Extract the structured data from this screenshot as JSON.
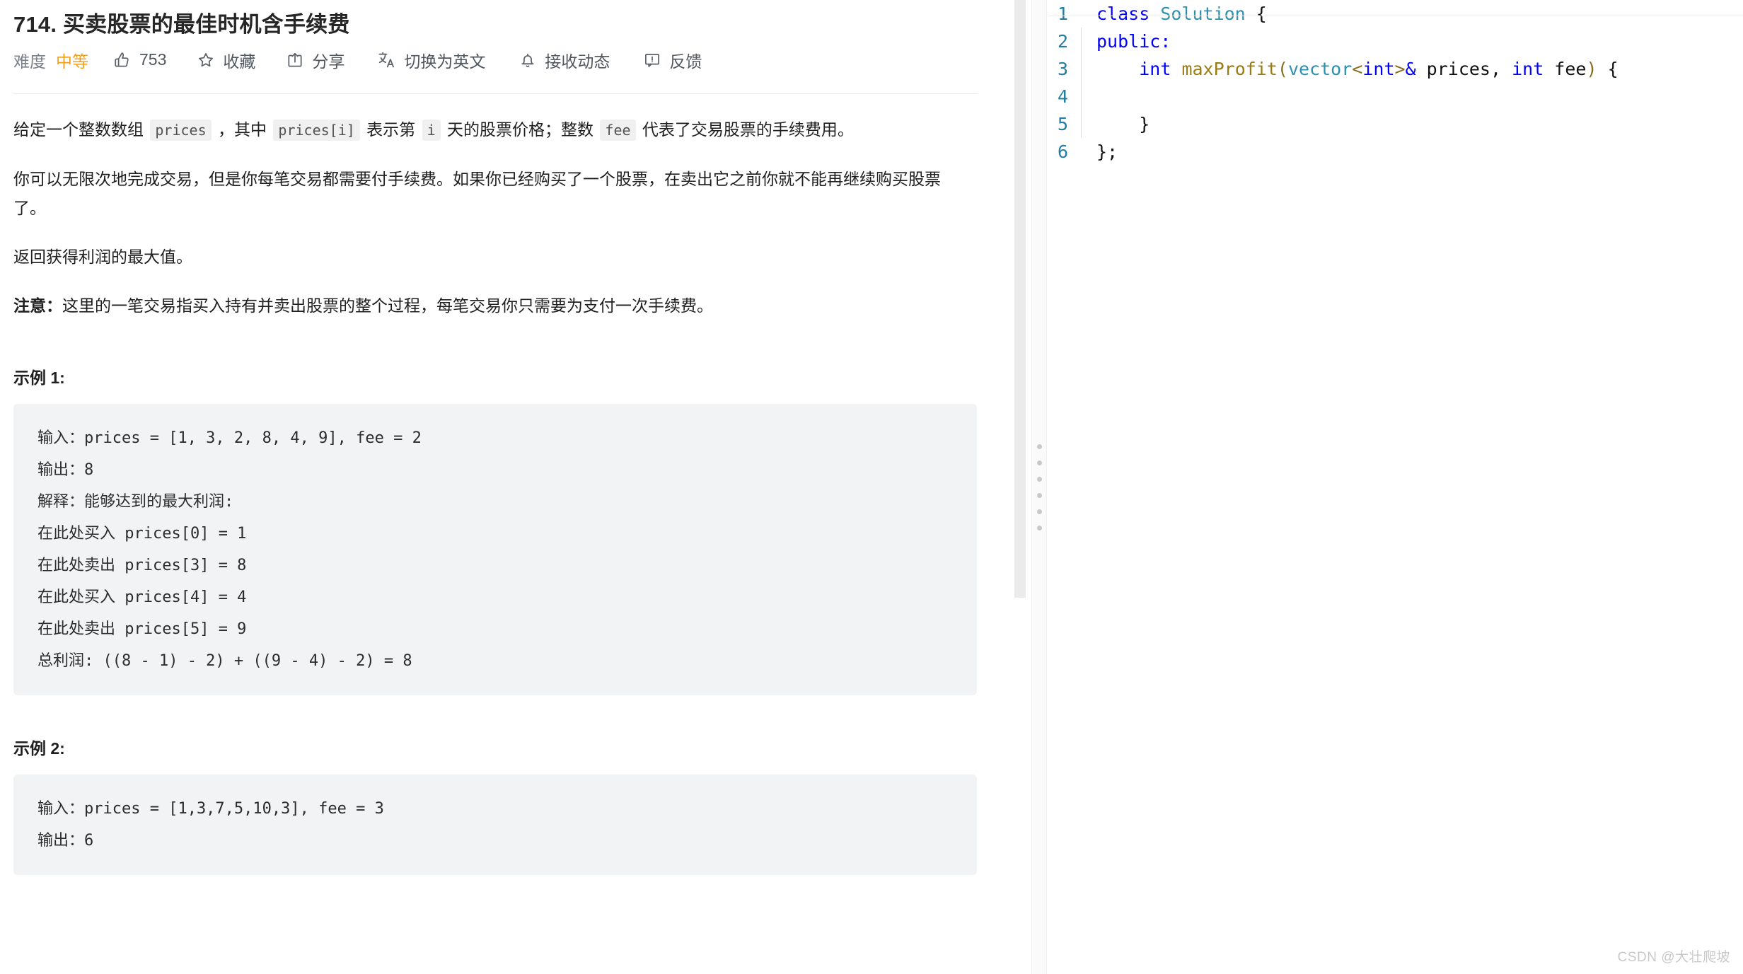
{
  "problem": {
    "title": "714. 买卖股票的最佳时机含手续费",
    "meta": {
      "difficulty_label": "难度",
      "difficulty_value": "中等",
      "difficulty_color": "#f0a020",
      "like_count": "753",
      "favorite_label": "收藏",
      "share_label": "分享",
      "translate_label": "切换为英文",
      "subscribe_label": "接收动态",
      "feedback_label": "反馈",
      "icons": {
        "thumbs_up": "thumbs-up-icon",
        "star": "star-icon",
        "share": "share-icon",
        "translate": "translate-icon",
        "bell": "bell-icon",
        "feedback": "feedback-icon"
      }
    },
    "paragraphs": [
      {
        "parts": [
          {
            "type": "text",
            "value": "给定一个整数数组 "
          },
          {
            "type": "code",
            "value": "prices"
          },
          {
            "type": "text",
            "value": " ，其中 "
          },
          {
            "type": "code",
            "value": "prices[i]"
          },
          {
            "type": "text",
            "value": " 表示第 "
          },
          {
            "type": "code",
            "value": "i"
          },
          {
            "type": "text",
            "value": " 天的股票价格；整数 "
          },
          {
            "type": "code",
            "value": "fee"
          },
          {
            "type": "text",
            "value": " 代表了交易股票的手续费用。"
          }
        ]
      },
      {
        "parts": [
          {
            "type": "text",
            "value": "你可以无限次地完成交易，但是你每笔交易都需要付手续费。如果你已经购买了一个股票，在卖出它之前你就不能再继续购买股票了。"
          }
        ]
      },
      {
        "parts": [
          {
            "type": "text",
            "value": "返回获得利润的最大值。"
          }
        ]
      },
      {
        "parts": [
          {
            "type": "strong",
            "value": "注意："
          },
          {
            "type": "text",
            "value": "这里的一笔交易指买入持有并卖出股票的整个过程，每笔交易你只需要为支付一次手续费。"
          }
        ]
      }
    ],
    "examples": [
      {
        "heading": "示例 1:",
        "code": "输入：prices = [1, 3, 2, 8, 4, 9], fee = 2\n输出：8\n解释：能够达到的最大利润:\n在此处买入 prices[0] = 1\n在此处卖出 prices[3] = 8\n在此处买入 prices[4] = 4\n在此处卖出 prices[5] = 9\n总利润: ((8 - 1) - 2) + ((9 - 4) - 2) = 8"
      },
      {
        "heading": "示例 2:",
        "code": "输入：prices = [1,3,7,5,10,3], fee = 3\n输出：6"
      }
    ]
  },
  "editor": {
    "language": "cpp",
    "lines": [
      {
        "number": "1",
        "guide": false,
        "tokens": [
          {
            "t": "kw",
            "v": "class"
          },
          {
            "t": "plain",
            "v": " "
          },
          {
            "t": "type",
            "v": "Solution"
          },
          {
            "t": "plain",
            "v": " {"
          }
        ]
      },
      {
        "number": "2",
        "guide": true,
        "tokens": [
          {
            "t": "kw",
            "v": "public:"
          }
        ]
      },
      {
        "number": "3",
        "guide": true,
        "tokens": [
          {
            "t": "plain",
            "v": "    "
          },
          {
            "t": "kw",
            "v": "int"
          },
          {
            "t": "plain",
            "v": " "
          },
          {
            "t": "fn",
            "v": "maxProfit"
          },
          {
            "t": "punct",
            "v": "("
          },
          {
            "t": "type",
            "v": "vector"
          },
          {
            "t": "punct",
            "v": "<"
          },
          {
            "t": "kw",
            "v": "int"
          },
          {
            "t": "punct",
            "v": ">"
          },
          {
            "t": "kw",
            "v": "&"
          },
          {
            "t": "plain",
            "v": " prices, "
          },
          {
            "t": "kw",
            "v": "int"
          },
          {
            "t": "plain",
            "v": " fee"
          },
          {
            "t": "punct",
            "v": ")"
          },
          {
            "t": "plain",
            "v": " {"
          }
        ]
      },
      {
        "number": "4",
        "guide": true,
        "tokens": []
      },
      {
        "number": "5",
        "guide": true,
        "tokens": [
          {
            "t": "plain",
            "v": "    }"
          }
        ]
      },
      {
        "number": "6",
        "guide": false,
        "tokens": [
          {
            "t": "plain",
            "v": "};"
          }
        ]
      }
    ]
  },
  "watermark": "CSDN @大壮爬坡"
}
